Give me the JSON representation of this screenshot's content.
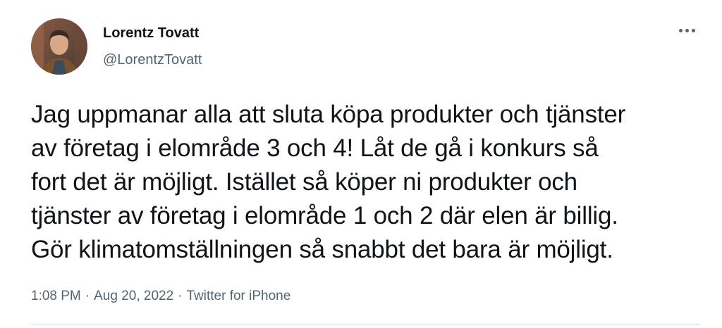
{
  "author": {
    "display_name": "Lorentz Tovatt",
    "handle": "@LorentzTovatt",
    "avatar_icon": "user-avatar-photo"
  },
  "tweet": {
    "text_lines": [
      "Jag uppmanar alla att sluta köpa produkter och tjänster",
      "av företag i elområde 3 och 4! Låt de gå i konkurs så",
      "fort det är möjligt. Istället så köper ni produkter och",
      "tjänster av företag i elområde 1 och 2 där elen är billig.",
      "Gör klimatomställningen så snabbt det bara är möjligt."
    ]
  },
  "meta": {
    "time": "1:08 PM",
    "separator": "·",
    "date": "Aug 20, 2022",
    "source": "Twitter for iPhone"
  },
  "actions": {
    "more_icon": "more-horizontal-icon"
  },
  "colors": {
    "text_primary": "#0f1419",
    "text_secondary": "#536471",
    "divider": "#cfd9de"
  }
}
